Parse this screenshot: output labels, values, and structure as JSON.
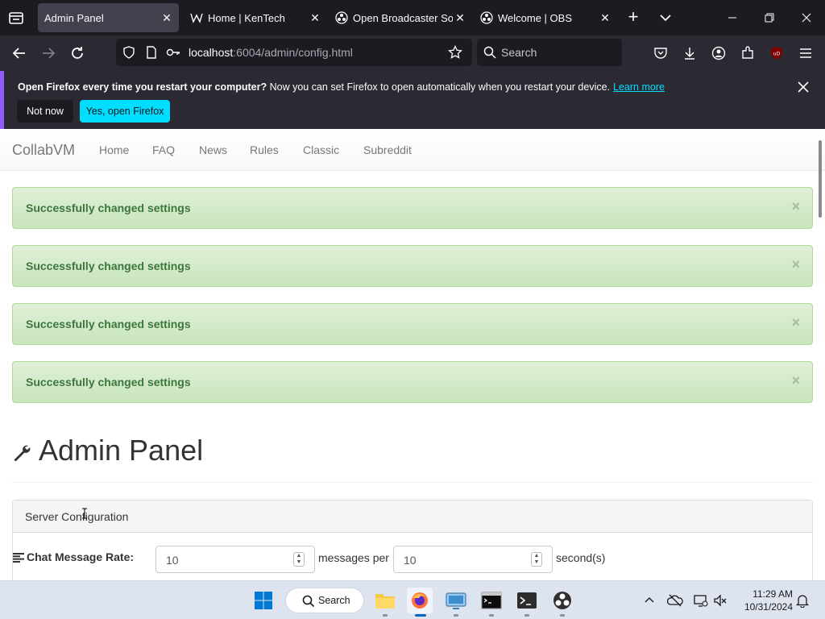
{
  "browser": {
    "tabs": [
      {
        "label": "Admin Panel",
        "icon": "none",
        "active": true
      },
      {
        "label": "Home | KenTech",
        "icon": "kentech-icon",
        "active": false
      },
      {
        "label": "Open Broadcaster Softw",
        "icon": "obs-icon",
        "active": false
      },
      {
        "label": "Welcome | OBS",
        "icon": "obs-icon",
        "active": false
      }
    ],
    "new_tab": "+",
    "url_host": "localhost",
    "url_rest": ":6004/admin/config.html",
    "search_placeholder": "Search",
    "extension_badge": "uD",
    "accent": "#00ddff"
  },
  "notification": {
    "bold_text": "Open Firefox every time you restart your computer?",
    "text": " Now you can set Firefox to open automatically when you restart your device.",
    "link": "Learn more",
    "not_now": "Not now",
    "yes_open": "Yes, open Firefox"
  },
  "site": {
    "brand": "CollabVM",
    "nav": [
      "Home",
      "FAQ",
      "News",
      "Rules",
      "Classic",
      "Subreddit"
    ],
    "alerts": [
      "Successfully changed settings",
      "Successfully changed settings",
      "Successfully changed settings",
      "Successfully changed settings"
    ],
    "alert_close": "×",
    "page_title": "Admin Panel",
    "panel_title": "Server Configuration",
    "chat_rate_label": "Chat Message Rate:",
    "messages_value": "10",
    "messages_per": "messages per",
    "seconds_value": "10",
    "seconds_label": "second(s)"
  },
  "taskbar": {
    "search_label": "Search",
    "time": "11:29 AM",
    "date": "10/31/2024"
  }
}
